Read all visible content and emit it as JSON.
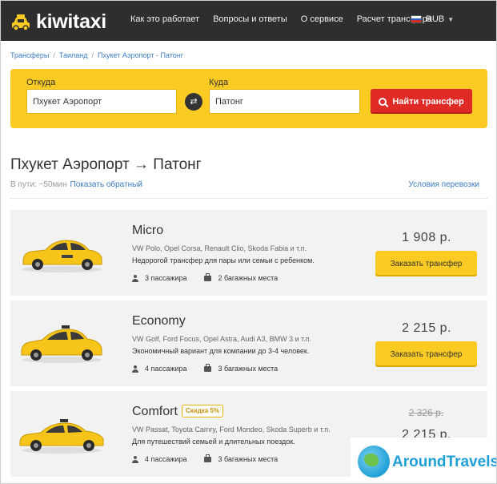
{
  "header": {
    "logo_text": "kiwitaxi",
    "nav": [
      "Как это работает",
      "Вопросы и ответы",
      "О сервисе",
      "Расчет трансфера"
    ],
    "currency": "RUB"
  },
  "breadcrumb": [
    "Трансферы",
    "Таиланд",
    "Пхукет Аэропорт - Патонг"
  ],
  "search": {
    "from_label": "Откуда",
    "from_value": "Пхукет Аэропорт",
    "to_label": "Куда",
    "to_value": "Патонг",
    "button_label": "Найти трансфер"
  },
  "route": {
    "title": "Пхукет Аэропорт → Патонг",
    "duration": "В пути: ~50мин",
    "reverse_link": "Показать обратный",
    "conditions_link": "Условия перевозки"
  },
  "cards": [
    {
      "title": "Micro",
      "models": "VW Polo, Opel Corsa, Renault Clio, Skoda Fabia и т.п.",
      "description": "Недорогой трансфер для пары или семьи с ребенком.",
      "passengers": "3 пассажира",
      "luggage": "2 багажных места",
      "price": "1 908  р.",
      "button_label": "Заказать трансфер"
    },
    {
      "title": "Economy",
      "models": "VW Golf, Ford Focus, Opel Astra, Audi A3, BMW 3 и т.п.",
      "description": "Экономичный вариант для компании до 3-4 человек.",
      "passengers": "4 пассажира",
      "luggage": "3 багажных места",
      "price": "2 215  р.",
      "button_label": "Заказать трансфер"
    },
    {
      "title": "Comfort",
      "discount": "Скидка 5%",
      "models": "VW Passat, Toyota Camry, Ford Mondeo, Skoda Superb и т.п.",
      "description": "Для путешествий семьей и длительных поездок.",
      "passengers": "4 пассажира",
      "luggage": "3 багажных места",
      "price_old": "2 326  р.",
      "price": "2 215  р."
    }
  ],
  "watermark": {
    "text": "AroundTravels"
  },
  "colors": {
    "accent": "#fbcb23",
    "header": "#2e2e2e",
    "button_red": "#e02a25",
    "link": "#3a7bbf"
  }
}
